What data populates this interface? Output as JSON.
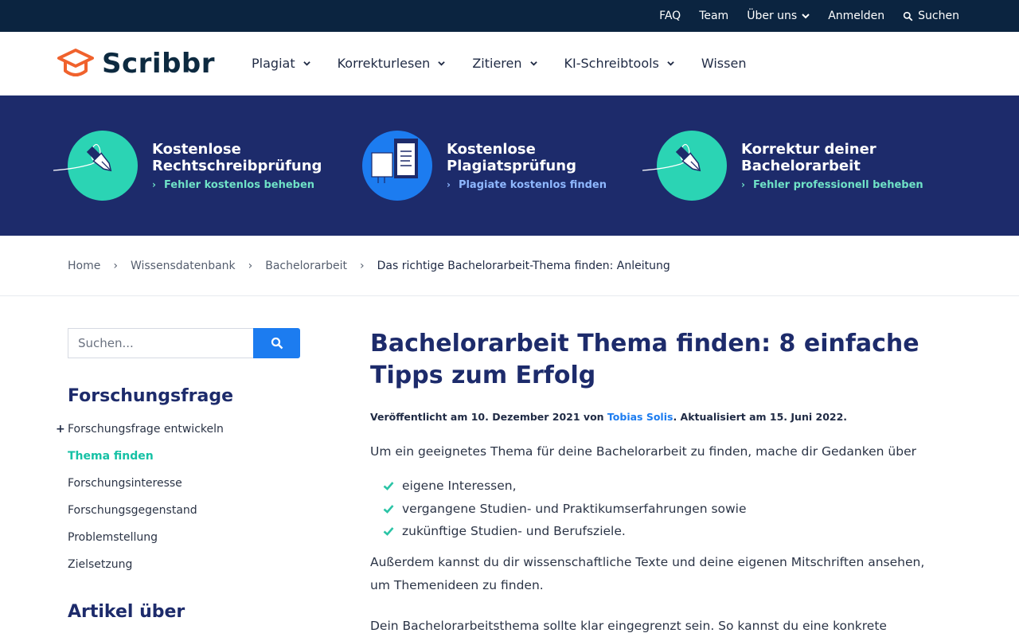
{
  "topbar": {
    "faq": "FAQ",
    "team": "Team",
    "about": "Über uns",
    "login": "Anmelden",
    "search": "Suchen"
  },
  "header": {
    "logo_text": "Scribbr",
    "nav": [
      "Plagiat",
      "Korrekturlesen",
      "Zitieren",
      "KI-Schreibtools",
      "Wissen"
    ]
  },
  "banner": {
    "promos": [
      {
        "title_line1": "Kostenlose",
        "title_line2": "Rechtschreibprüfung",
        "link": "Fehler kostenlos beheben"
      },
      {
        "title_line1": "Kostenlose",
        "title_line2": "Plagiatsprüfung",
        "link": "Plagiate kostenlos finden"
      },
      {
        "title_line1": "Korrektur deiner",
        "title_line2": "Bachelorarbeit",
        "link": "Fehler professionell beheben"
      }
    ]
  },
  "breadcrumb": [
    "Home",
    "Wissensdatenbank",
    "Bachelorarbeit",
    "Das richtige Bachelorarbeit-Thema finden: Anleitung"
  ],
  "sidebar": {
    "search_placeholder": "Suchen...",
    "heading": "Forschungsfrage",
    "items": [
      "Forschungsfrage entwickeln",
      "Thema finden",
      "Forschungsinteresse",
      "Forschungsgegenstand",
      "Problemstellung",
      "Zielsetzung"
    ],
    "heading2": "Artikel über"
  },
  "article": {
    "title": "Bachelorarbeit Thema finden: 8 einfache Tipps zum Erfolg",
    "meta_prefix": "Veröffentlicht am 10. Dezember 2021 von ",
    "author": "Tobias Solis",
    "meta_suffix": ". Aktualisiert am 15. Juni 2022.",
    "intro": "Um ein geeignetes Thema für deine Bachelorarbeit zu finden, mache dir Gedanken über",
    "checklist": [
      "eigene Interessen,",
      "vergangene Studien- und Praktikumserfahrungen sowie",
      "zukünftige Studien- und Berufsziele."
    ],
    "para2": "Außerdem kannst du dir wissenschaftliche Texte und deine eigenen Mitschriften ansehen, um Themenideen zu finden.",
    "para3": "Dein Bachelorarbeitsthema sollte klar eingegrenzt sein. So kannst du eine konkrete"
  },
  "colors": {
    "topbar": "#0b2440",
    "banner": "#1d2b6b",
    "accent_teal": "#2bd4b4",
    "accent_blue": "#1c7cf0",
    "logo_orange": "#f0622d"
  }
}
